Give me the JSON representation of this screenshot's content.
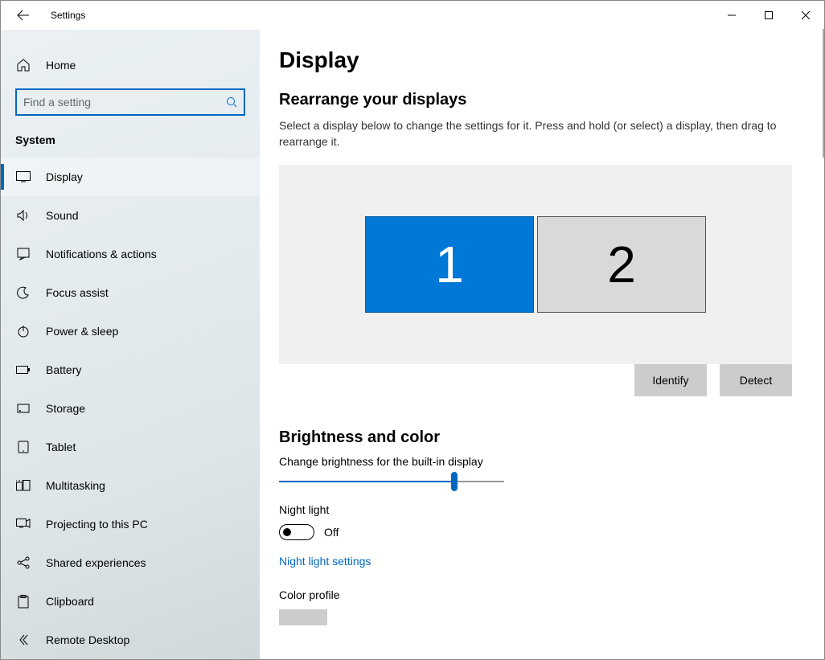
{
  "titlebar": {
    "title": "Settings"
  },
  "sidebar": {
    "home_label": "Home",
    "search_placeholder": "Find a setting",
    "section_label": "System",
    "items": [
      {
        "icon": "display-icon",
        "label": "Display",
        "active": true
      },
      {
        "icon": "sound-icon",
        "label": "Sound",
        "active": false
      },
      {
        "icon": "notify-icon",
        "label": "Notifications & actions",
        "active": false
      },
      {
        "icon": "moon-icon",
        "label": "Focus assist",
        "active": false
      },
      {
        "icon": "power-icon",
        "label": "Power & sleep",
        "active": false
      },
      {
        "icon": "battery-icon",
        "label": "Battery",
        "active": false
      },
      {
        "icon": "storage-icon",
        "label": "Storage",
        "active": false
      },
      {
        "icon": "tablet-icon",
        "label": "Tablet",
        "active": false
      },
      {
        "icon": "multitask-icon",
        "label": "Multitasking",
        "active": false
      },
      {
        "icon": "project-icon",
        "label": "Projecting to this PC",
        "active": false
      },
      {
        "icon": "share-icon",
        "label": "Shared experiences",
        "active": false
      },
      {
        "icon": "clipboard-icon",
        "label": "Clipboard",
        "active": false
      },
      {
        "icon": "remote-icon",
        "label": "Remote Desktop",
        "active": false
      }
    ]
  },
  "main": {
    "page_title": "Display",
    "rearrange_heading": "Rearrange your displays",
    "rearrange_desc": "Select a display below to change the settings for it. Press and hold (or select) a display, then drag to rearrange it.",
    "monitors": {
      "primary": "1",
      "secondary": "2"
    },
    "identify_label": "Identify",
    "detect_label": "Detect",
    "brightness_heading": "Brightness and color",
    "brightness_label": "Change brightness for the built-in display",
    "brightness_percent": 78,
    "nightlight_label": "Night light",
    "nightlight_state_label": "Off",
    "nightlight_settings_link": "Night light settings",
    "color_profile_label": "Color profile"
  }
}
